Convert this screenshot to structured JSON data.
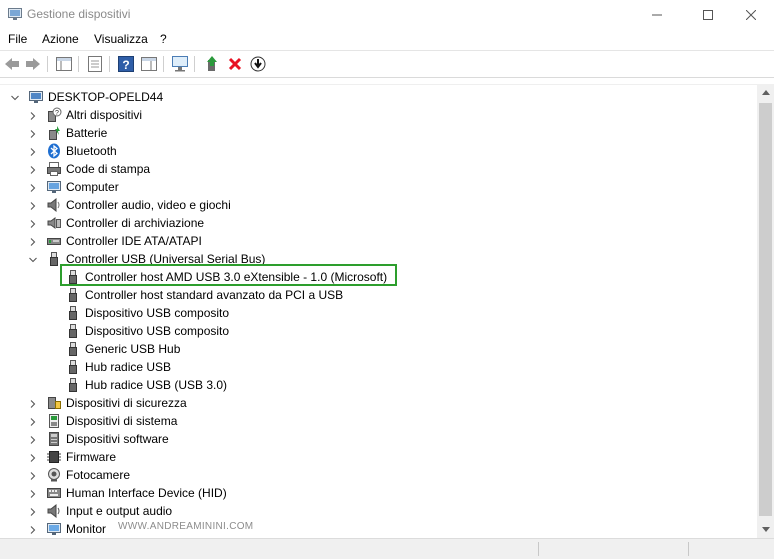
{
  "window": {
    "title": "Gestione dispositivi"
  },
  "menu": [
    "File",
    "Azione",
    "Visualizza",
    "?"
  ],
  "tree": {
    "root": "DESKTOP-OPELD44",
    "categories": [
      {
        "label": "Altri dispositivi",
        "icon": "unknown-device-icon"
      },
      {
        "label": "Batterie",
        "icon": "battery-icon"
      },
      {
        "label": "Bluetooth",
        "icon": "bluetooth-icon"
      },
      {
        "label": "Code di stampa",
        "icon": "print-queue-icon"
      },
      {
        "label": "Computer",
        "icon": "computer-icon"
      },
      {
        "label": "Controller audio, video e giochi",
        "icon": "speaker-icon"
      },
      {
        "label": "Controller di archiviazione",
        "icon": "storage-controller-icon"
      },
      {
        "label": "Controller IDE ATA/ATAPI",
        "icon": "ide-controller-icon"
      },
      {
        "label": "Controller USB (Universal Serial Bus)",
        "icon": "usb-icon",
        "expanded": true
      }
    ],
    "usb_children": [
      "Controller host AMD USB 3.0 eXtensible - 1.0 (Microsoft)",
      "Controller host standard avanzato da PCI a USB",
      "Dispositivo USB composito",
      "Dispositivo USB composito",
      "Generic USB Hub",
      "Hub radice USB",
      "Hub radice USB (USB 3.0)"
    ],
    "categories_after": [
      {
        "label": "Dispositivi di sicurezza",
        "icon": "security-device-icon"
      },
      {
        "label": "Dispositivi di sistema",
        "icon": "system-device-icon"
      },
      {
        "label": "Dispositivi software",
        "icon": "software-device-icon"
      },
      {
        "label": "Firmware",
        "icon": "firmware-icon"
      },
      {
        "label": "Fotocamere",
        "icon": "camera-icon"
      },
      {
        "label": "Human Interface Device (HID)",
        "icon": "hid-icon"
      },
      {
        "label": "Input e output audio",
        "icon": "audio-io-icon"
      },
      {
        "label": "Monitor",
        "icon": "monitor-icon"
      }
    ],
    "highlighted_item": "Controller host AMD USB 3.0 eXtensible - 1.0 (Microsoft)"
  },
  "watermark": "WWW.ANDREAMININI.COM",
  "colors": {
    "highlight_border": "#2d9e2d",
    "delete_icon": "#e81123"
  }
}
